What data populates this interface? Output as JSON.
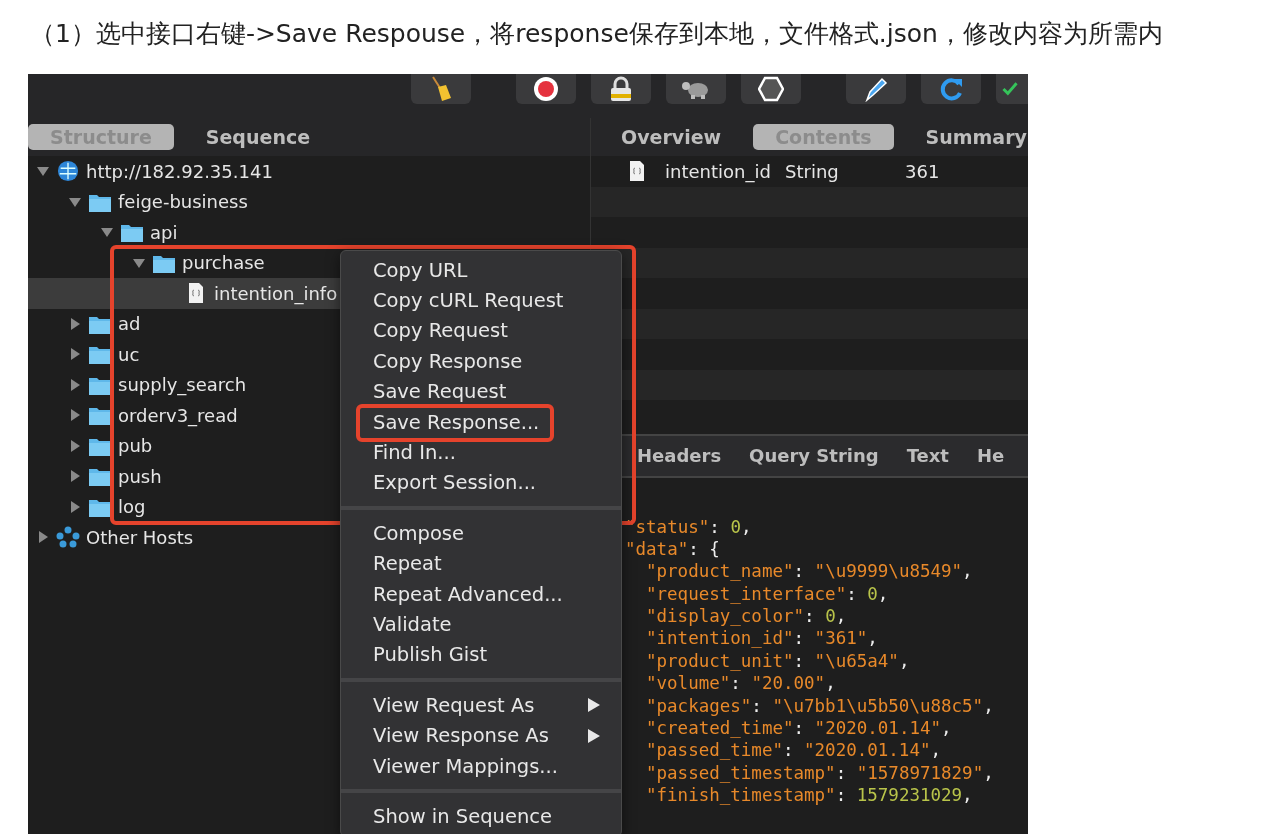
{
  "instruction": "（1）选中接口右键->Save Respouse，将response保存到本地，文件格式.json，修改内容为所需内",
  "left_tabs": [
    {
      "label": "Structure",
      "selected": true
    },
    {
      "label": "Sequence",
      "selected": false
    }
  ],
  "tree": [
    {
      "label": "http://182.92.35.141",
      "kind": "host",
      "expanded": true,
      "selected": false,
      "children": [
        {
          "label": "feige-business",
          "kind": "folder",
          "expanded": true,
          "selected": false,
          "children": [
            {
              "label": "api",
              "kind": "folder",
              "expanded": true,
              "selected": false,
              "children": [
                {
                  "label": "purchase",
                  "kind": "folder",
                  "expanded": true,
                  "selected": false,
                  "children": [
                    {
                      "label": "intention_info",
                      "kind": "file",
                      "selected": true
                    }
                  ]
                }
              ]
            }
          ]
        },
        {
          "label": "ad",
          "kind": "folder",
          "expanded": false,
          "selected": false
        },
        {
          "label": "uc",
          "kind": "folder",
          "expanded": false,
          "selected": false
        },
        {
          "label": "supply_search",
          "kind": "folder",
          "expanded": false,
          "selected": false
        },
        {
          "label": "orderv3_read",
          "kind": "folder",
          "expanded": false,
          "selected": false
        },
        {
          "label": "pub",
          "kind": "folder",
          "expanded": false,
          "selected": false
        },
        {
          "label": "push",
          "kind": "folder",
          "expanded": false,
          "selected": false
        },
        {
          "label": "log",
          "kind": "folder",
          "expanded": false,
          "selected": false
        }
      ]
    },
    {
      "label": "Other Hosts",
      "kind": "hosts",
      "expanded": false,
      "selected": false
    }
  ],
  "right_tabs": [
    {
      "label": "Overview",
      "selected": false
    },
    {
      "label": "Contents",
      "selected": true
    },
    {
      "label": "Summary",
      "selected": false
    }
  ],
  "contents_rows": [
    {
      "name": "intention_id",
      "type": "String",
      "value": "361"
    }
  ],
  "lower_tabs": [
    {
      "label": "Headers"
    },
    {
      "label": "Query String"
    },
    {
      "label": "Text"
    },
    {
      "label": "He"
    }
  ],
  "code": [
    {
      "tokens": [
        {
          "kind": "key",
          "text": "\"status\""
        },
        {
          "kind": "punct",
          "text": ": "
        },
        {
          "kind": "number",
          "text": "0"
        },
        {
          "kind": "punct",
          "text": ","
        }
      ]
    },
    {
      "tokens": [
        {
          "kind": "key",
          "text": "\"data\""
        },
        {
          "kind": "punct",
          "text": ": {"
        }
      ],
      "children": [
        {
          "tokens": [
            {
              "kind": "key",
              "text": "\"product_name\""
            },
            {
              "kind": "punct",
              "text": ": "
            },
            {
              "kind": "string",
              "text": "\"\\u9999\\u8549\""
            },
            {
              "kind": "punct",
              "text": ","
            }
          ]
        },
        {
          "tokens": [
            {
              "kind": "key",
              "text": "\"request_interface\""
            },
            {
              "kind": "punct",
              "text": ": "
            },
            {
              "kind": "number",
              "text": "0"
            },
            {
              "kind": "punct",
              "text": ","
            }
          ]
        },
        {
          "tokens": [
            {
              "kind": "key",
              "text": "\"display_color\""
            },
            {
              "kind": "punct",
              "text": ": "
            },
            {
              "kind": "number",
              "text": "0"
            },
            {
              "kind": "punct",
              "text": ","
            }
          ]
        },
        {
          "tokens": [
            {
              "kind": "key",
              "text": "\"intention_id\""
            },
            {
              "kind": "punct",
              "text": ": "
            },
            {
              "kind": "string",
              "text": "\"361\""
            },
            {
              "kind": "punct",
              "text": ","
            }
          ]
        },
        {
          "tokens": [
            {
              "kind": "key",
              "text": "\"product_unit\""
            },
            {
              "kind": "punct",
              "text": ": "
            },
            {
              "kind": "string",
              "text": "\"\\u65a4\""
            },
            {
              "kind": "punct",
              "text": ","
            }
          ]
        },
        {
          "tokens": [
            {
              "kind": "key",
              "text": "\"volume\""
            },
            {
              "kind": "punct",
              "text": ": "
            },
            {
              "kind": "string",
              "text": "\"20.00\""
            },
            {
              "kind": "punct",
              "text": ","
            }
          ]
        },
        {
          "tokens": [
            {
              "kind": "key",
              "text": "\"packages\""
            },
            {
              "kind": "punct",
              "text": ": "
            },
            {
              "kind": "string",
              "text": "\"\\u7bb1\\u5b50\\u88c5\""
            },
            {
              "kind": "punct",
              "text": ","
            }
          ]
        },
        {
          "tokens": [
            {
              "kind": "key",
              "text": "\"created_time\""
            },
            {
              "kind": "punct",
              "text": ": "
            },
            {
              "kind": "string",
              "text": "\"2020.01.14\""
            },
            {
              "kind": "punct",
              "text": ","
            }
          ]
        },
        {
          "tokens": [
            {
              "kind": "key",
              "text": "\"passed_time\""
            },
            {
              "kind": "punct",
              "text": ": "
            },
            {
              "kind": "string",
              "text": "\"2020.01.14\""
            },
            {
              "kind": "punct",
              "text": ","
            }
          ]
        },
        {
          "tokens": [
            {
              "kind": "key",
              "text": "\"passed_timestamp\""
            },
            {
              "kind": "punct",
              "text": ": "
            },
            {
              "kind": "string",
              "text": "\"1578971829\""
            },
            {
              "kind": "punct",
              "text": ","
            }
          ]
        },
        {
          "tokens": [
            {
              "kind": "key",
              "text": "\"finish_timestamp\""
            },
            {
              "kind": "punct",
              "text": ": "
            },
            {
              "kind": "number",
              "text": "1579231029"
            },
            {
              "kind": "punct",
              "text": ","
            }
          ]
        }
      ]
    }
  ],
  "menu": [
    [
      {
        "label": "Copy URL",
        "submenu": false,
        "marked": false
      },
      {
        "label": "Copy cURL Request",
        "submenu": false,
        "marked": false
      },
      {
        "label": "Copy Request",
        "submenu": false,
        "marked": false
      },
      {
        "label": "Copy Response",
        "submenu": false,
        "marked": false
      },
      {
        "label": "Save Request",
        "submenu": false,
        "marked": false
      },
      {
        "label": "Save Response...",
        "submenu": false,
        "marked": true
      },
      {
        "label": "Find In...",
        "submenu": false,
        "marked": false
      },
      {
        "label": "Export Session...",
        "submenu": false,
        "marked": false
      }
    ],
    [
      {
        "label": "Compose",
        "submenu": false,
        "marked": false
      },
      {
        "label": "Repeat",
        "submenu": false,
        "marked": false
      },
      {
        "label": "Repeat Advanced...",
        "submenu": false,
        "marked": false
      },
      {
        "label": "Validate",
        "submenu": false,
        "marked": false
      },
      {
        "label": "Publish Gist",
        "submenu": false,
        "marked": false
      }
    ],
    [
      {
        "label": "View Request As",
        "submenu": true,
        "marked": false
      },
      {
        "label": "View Response As",
        "submenu": true,
        "marked": false
      },
      {
        "label": "Viewer Mappings...",
        "submenu": false,
        "marked": false
      }
    ],
    [
      {
        "label": "Show in Sequence",
        "submenu": false,
        "marked": false
      }
    ]
  ]
}
